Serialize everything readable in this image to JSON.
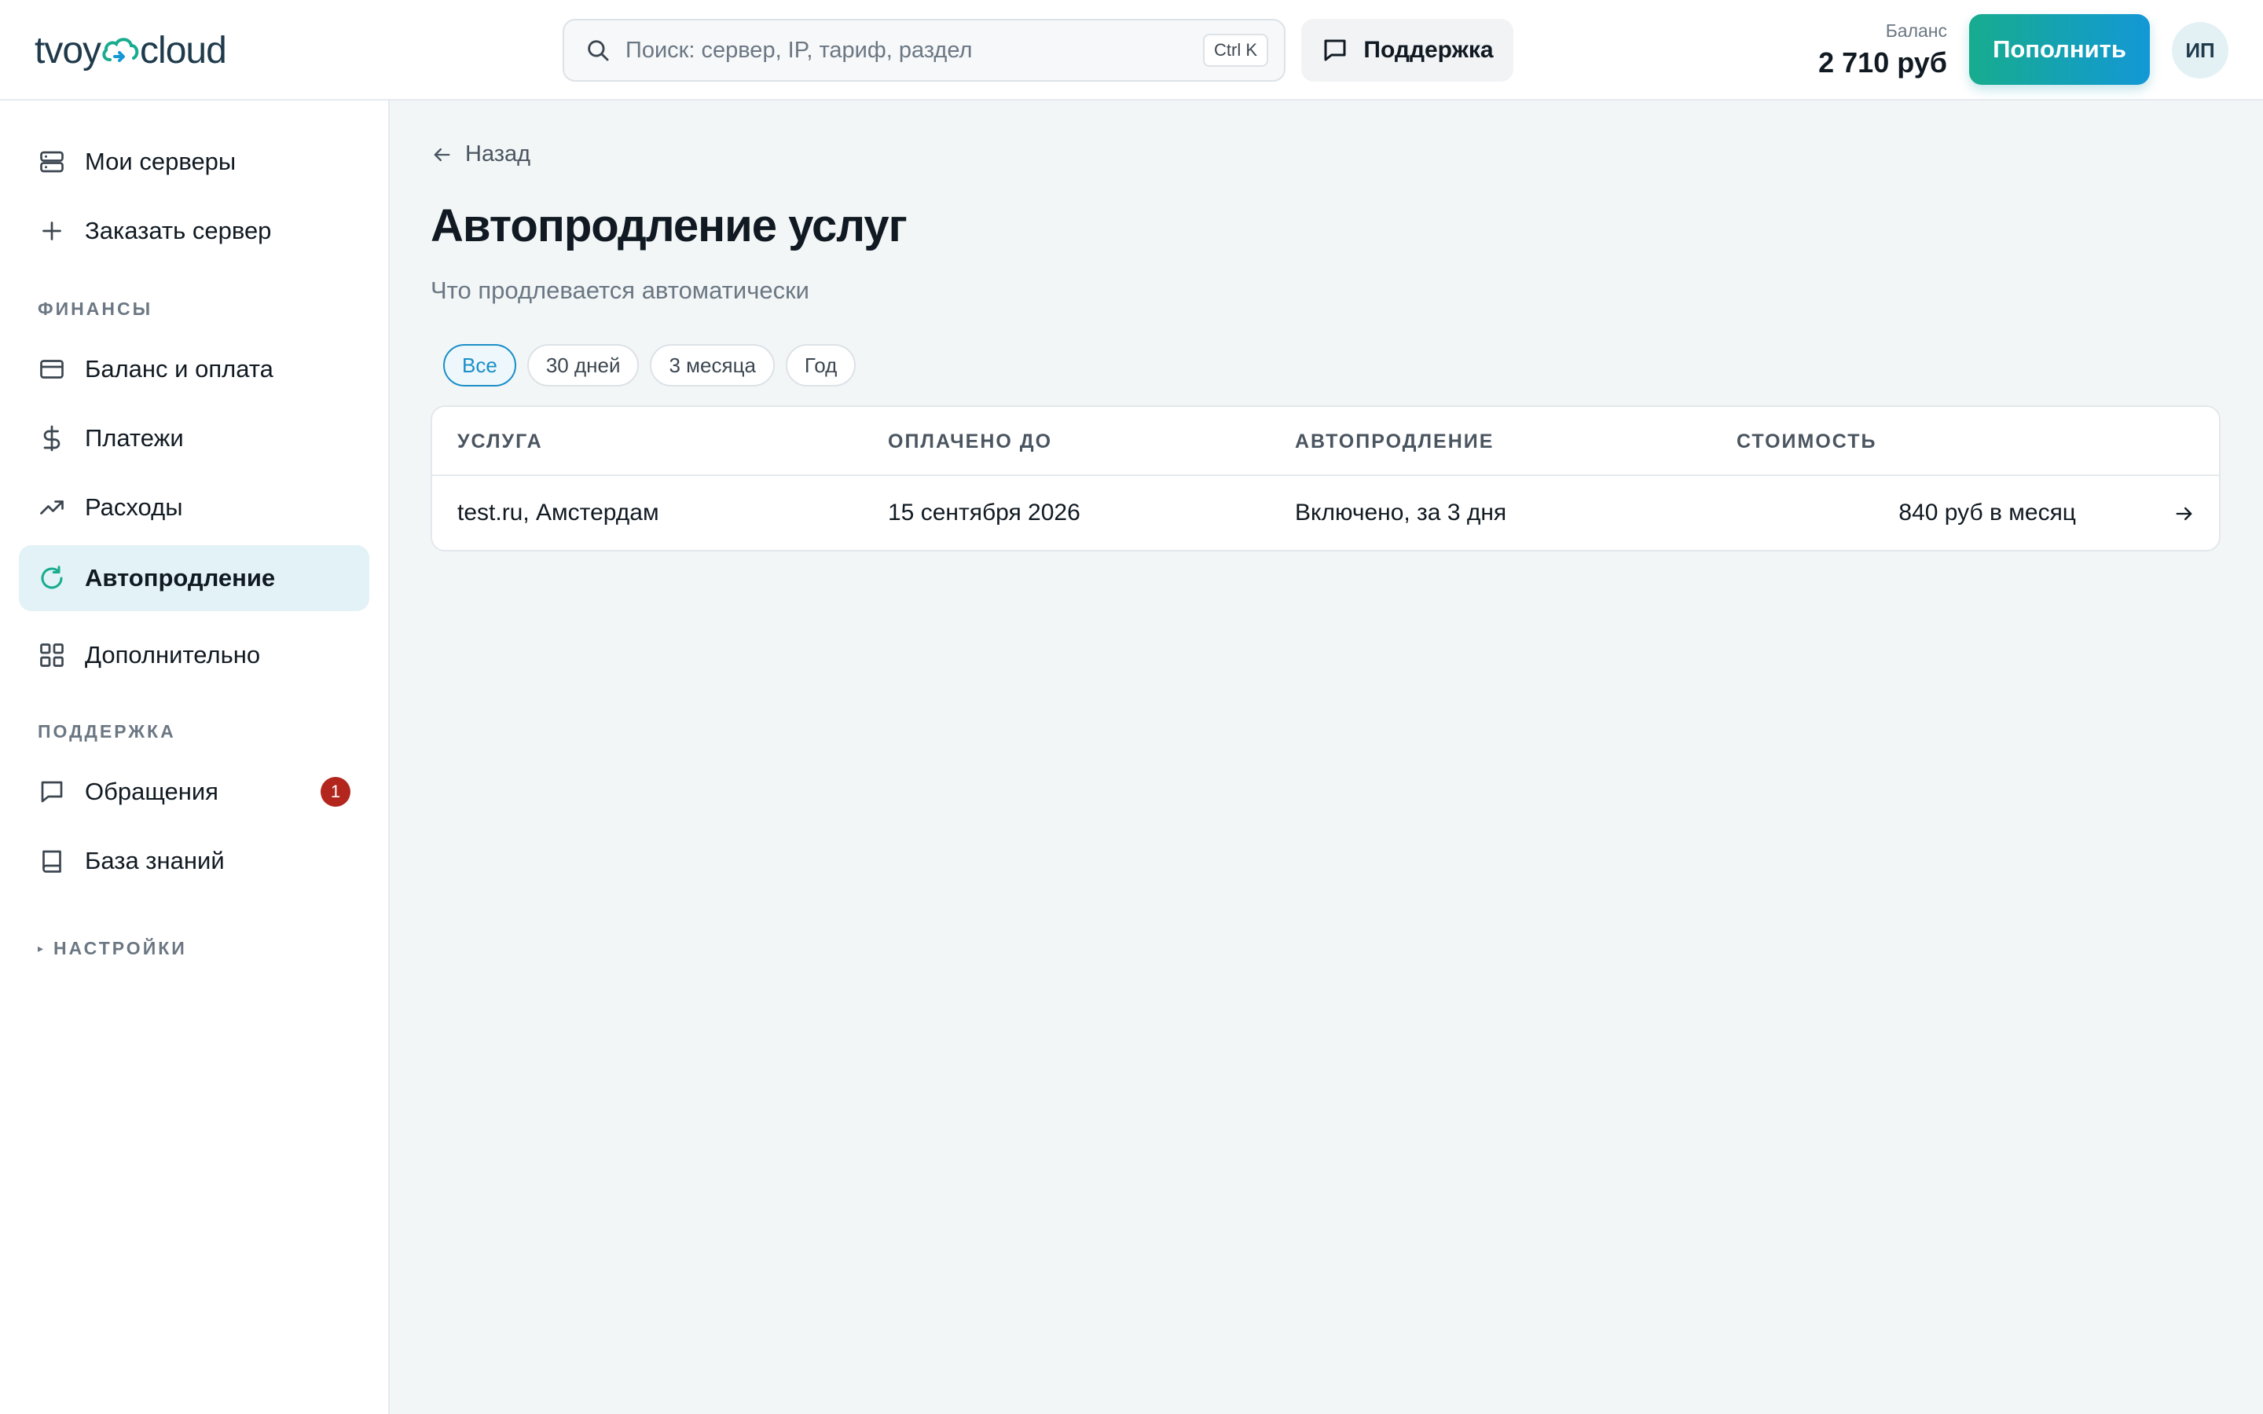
{
  "brand": {
    "logo_left": "tvoy",
    "logo_right": "cloud"
  },
  "header": {
    "search_placeholder": "Поиск: сервер, IP, тариф, раздел",
    "search_shortcut": "Ctrl K",
    "support_label": "Поддержка",
    "balance_label": "Баланс",
    "balance_value": "2 710 руб",
    "topup_label": "Пополнить",
    "avatar_initials": "ИП"
  },
  "sidebar": {
    "items_top": [
      {
        "label": "Мои серверы",
        "icon": "server-icon"
      },
      {
        "label": "Заказать сервер",
        "icon": "plus-icon"
      }
    ],
    "finance_section": "ФИНАНСЫ",
    "finance_items": [
      {
        "label": "Баланс и оплата",
        "icon": "credit-card-icon"
      },
      {
        "label": "Платежи",
        "icon": "dollar-icon"
      },
      {
        "label": "Расходы",
        "icon": "trending-up-icon"
      },
      {
        "label": "Автопродление",
        "icon": "refresh-icon",
        "active": true
      },
      {
        "label": "Дополнительно",
        "icon": "grid-icon"
      }
    ],
    "support_section": "ПОДДЕРЖКА",
    "support_items": [
      {
        "label": "Обращения",
        "icon": "message-icon",
        "badge": "1"
      },
      {
        "label": "База знаний",
        "icon": "book-icon"
      }
    ],
    "settings_section": "НАСТРОЙКИ"
  },
  "main": {
    "back_label": "Назад",
    "title": "Автопродление услуг",
    "subtitle": "Что продлевается автоматически",
    "filters": [
      "Все",
      "30 дней",
      "3 месяца",
      "Год"
    ],
    "active_filter": "Все",
    "table": {
      "headers": [
        "УСЛУГА",
        "ОПЛАЧЕНО ДО",
        "АВТОПРОДЛЕНИЕ",
        "СТОИМОСТЬ"
      ],
      "rows": [
        {
          "service": "test.ru, Амстердам",
          "paid_until": "15 сентября 2026",
          "autorenew": "Включено, за 3 дня",
          "cost": "840 руб в месяц"
        }
      ]
    }
  },
  "colors": {
    "accent": "#1a8fc8",
    "accent_green": "#17ac8e",
    "badge": "#b3261e",
    "active_bg": "#e3f2f7"
  }
}
